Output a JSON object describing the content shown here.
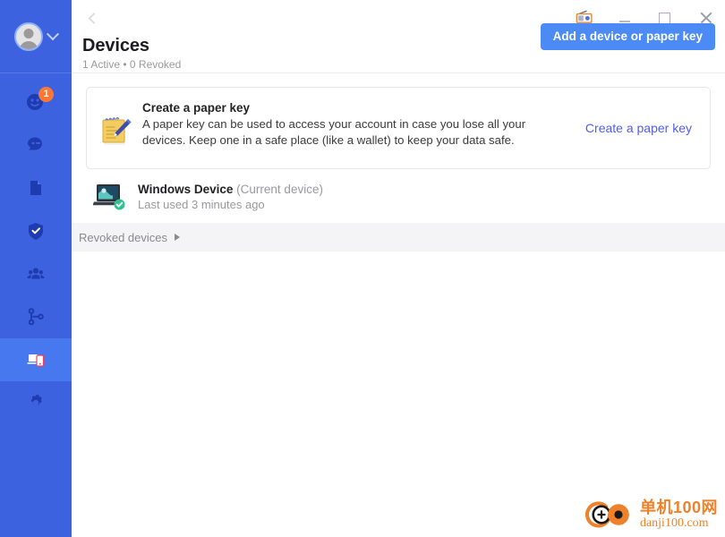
{
  "window": {
    "controls": [
      {
        "name": "radio-icon",
        "label": "Radio"
      },
      {
        "name": "minimize-button",
        "label": "Minimize"
      },
      {
        "name": "maximize-button",
        "label": "Maximize"
      },
      {
        "name": "close-button",
        "label": "Close"
      }
    ]
  },
  "sidebar": {
    "avatar": {
      "name": "avatar",
      "chevron": "chevron-down-icon"
    },
    "items": [
      {
        "icon": "people-smiley-icon",
        "badge": "1",
        "active": false
      },
      {
        "icon": "chat-bubble-icon",
        "badge": "",
        "active": false
      },
      {
        "icon": "files-icon",
        "badge": "",
        "active": false
      },
      {
        "icon": "shield-check-icon",
        "badge": "",
        "active": false
      },
      {
        "icon": "teams-icon",
        "badge": "",
        "active": false
      },
      {
        "icon": "git-branch-icon",
        "badge": "",
        "active": false
      },
      {
        "icon": "devices-icon",
        "badge": "",
        "active": true
      },
      {
        "icon": "gear-icon",
        "badge": "",
        "active": false
      }
    ]
  },
  "header": {
    "back_label": "Back",
    "title": "Devices",
    "subtitle": "1 Active • 0 Revoked",
    "add_button_label": "Add a device or paper key"
  },
  "paper_key_card": {
    "icon": "notepad-pen-icon",
    "title": "Create a paper key",
    "description": "A paper key can be used to access your account in case you lose all your devices. Keep one in a safe place (like a wallet) to keep your data safe.",
    "link_label": "Create a paper key"
  },
  "devices": [
    {
      "icon": "laptop-icon",
      "badge": "verified-check-badge",
      "name": "Windows Device",
      "current_label": "(Current device)",
      "last_used": "Last used 3 minutes ago"
    }
  ],
  "revoked_section": {
    "label": "Revoked devices",
    "arrow": "triangle-right-icon"
  },
  "watermark": {
    "logo": "danji-logo-icon",
    "cn": "单机100网",
    "en": "danji100.com"
  },
  "colors": {
    "sidebar_bg": "#3d62e0",
    "sidebar_active": "#4878ef",
    "accent_button": "#4c8bf5",
    "link": "#4e5ff2",
    "badge": "#ff7733",
    "watermark": "#f0812b"
  }
}
